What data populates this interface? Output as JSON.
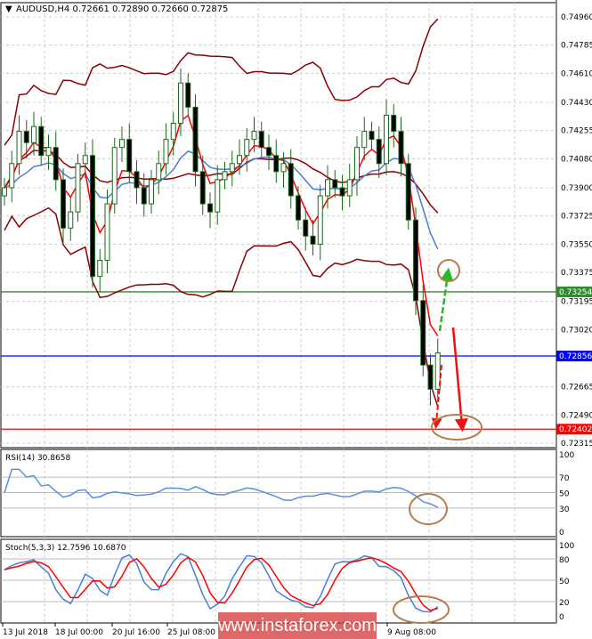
{
  "header": {
    "symbol": "AUDUSD,H4",
    "ohlc": "0.72661 0.72890 0.72660 0.72875"
  },
  "price_axis": [
    "0.74960",
    "0.74785",
    "0.74610",
    "0.74430",
    "0.74255",
    "0.74080",
    "0.73900",
    "0.73725",
    "0.73550",
    "0.73375",
    "0.73195",
    "0.73020",
    "0.72665",
    "0.72490",
    "0.72315"
  ],
  "levels": [
    {
      "label": "0.73254",
      "value": 0.73254,
      "color": "#2e8b2e"
    },
    {
      "label": "0.72856",
      "value": 0.72856,
      "color": "#0000ff"
    },
    {
      "label": "0.72402",
      "value": 0.72402,
      "color": "#ff0000"
    }
  ],
  "rsi": {
    "label": "RSI(14) 30.8658",
    "axis": [
      "100",
      "70",
      "50",
      "30",
      "0"
    ]
  },
  "stoch": {
    "label": "Stoch(5,3,3) 12.7596 10.6870",
    "axis": [
      "100",
      "80",
      "50",
      "20",
      "0"
    ]
  },
  "time_axis": [
    "13 Jul 2018",
    "18 Jul 00:00",
    "20 Jul 16:00",
    "25 Jul 08:00",
    "9 Aug 08:00"
  ],
  "watermark": "www.instaforex.com",
  "chart_data": {
    "type": "candlestick",
    "title": "AUDUSD,H4",
    "ylim": [
      0.72315,
      0.7496
    ],
    "closes": [
      0.739,
      0.7405,
      0.7425,
      0.7418,
      0.7428,
      0.741,
      0.7415,
      0.7395,
      0.7365,
      0.7375,
      0.7405,
      0.741,
      0.7335,
      0.7345,
      0.738,
      0.7415,
      0.742,
      0.74,
      0.739,
      0.738,
      0.7395,
      0.7405,
      0.742,
      0.743,
      0.7455,
      0.744,
      0.74,
      0.738,
      0.7375,
      0.7395,
      0.74,
      0.7405,
      0.741,
      0.742,
      0.7425,
      0.7415,
      0.741,
      0.74,
      0.7405,
      0.7385,
      0.737,
      0.736,
      0.7355,
      0.7385,
      0.7395,
      0.739,
      0.7385,
      0.7395,
      0.7415,
      0.7425,
      0.742,
      0.7405,
      0.7435,
      0.7425,
      0.7405,
      0.737,
      0.732,
      0.728,
      0.7265,
      0.72875
    ],
    "colors": {
      "bull": "#2e8b2e",
      "bear": "#2e8b2e",
      "fast_ma": "#ff0000",
      "slow_ma": "#4a7fd4",
      "bands": "#8b0000",
      "annotation": "#b87c4c"
    }
  }
}
